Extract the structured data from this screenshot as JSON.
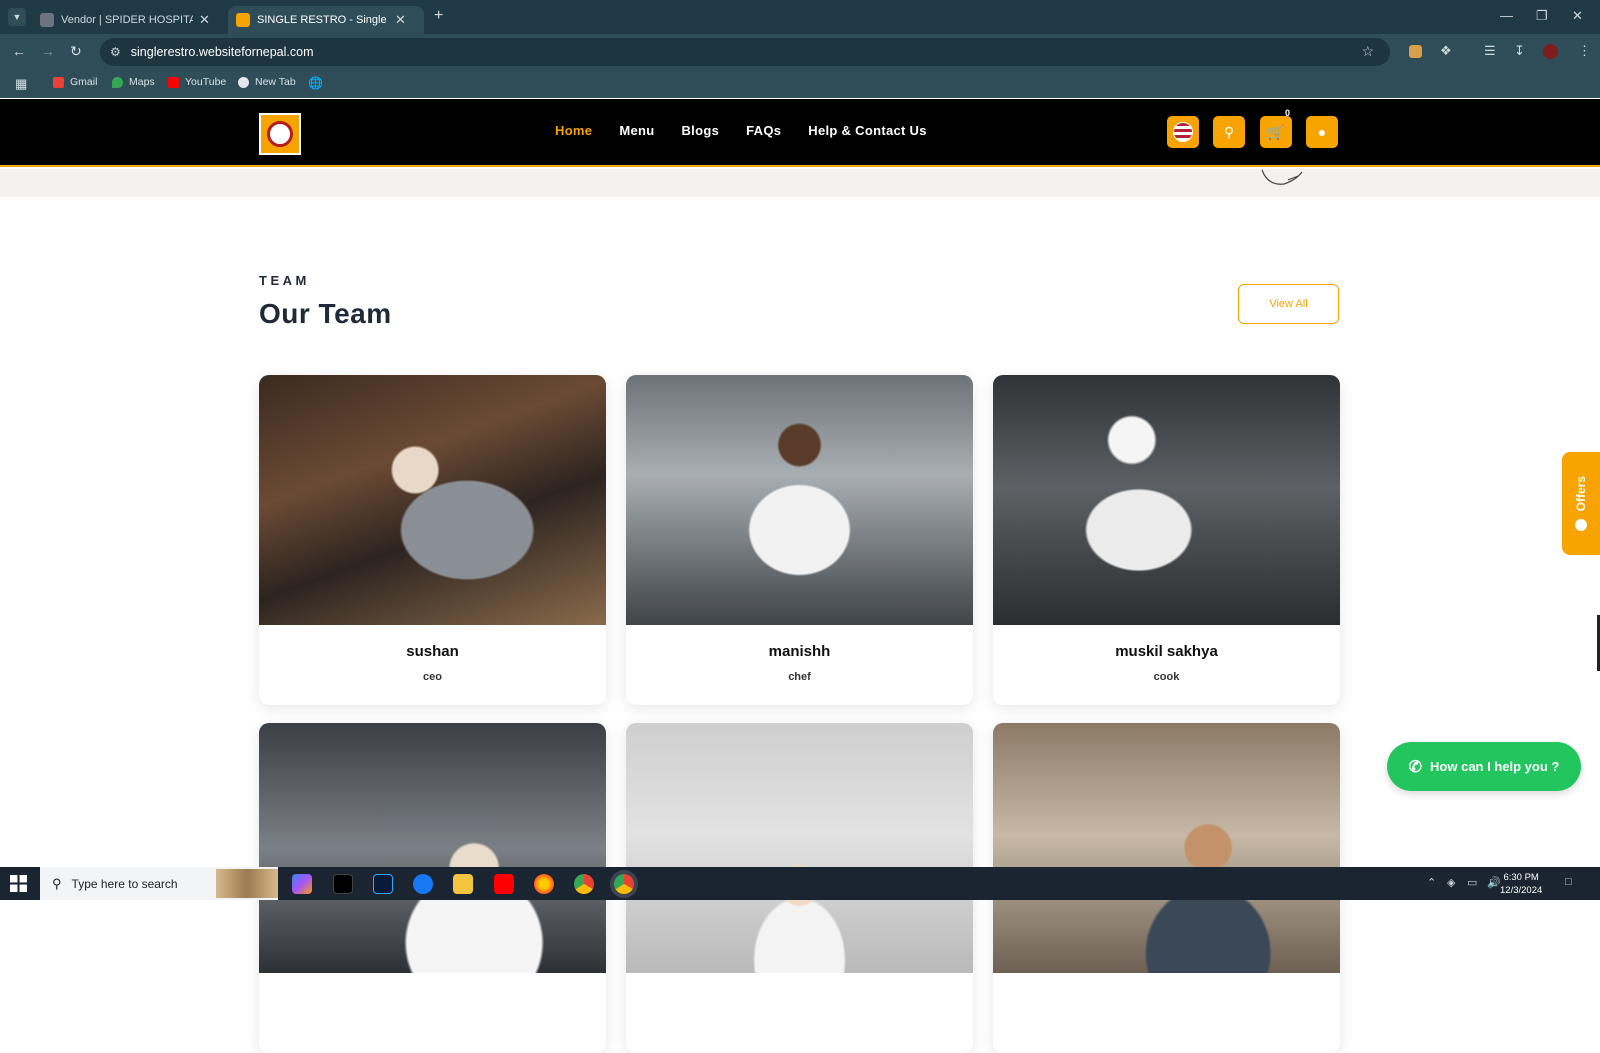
{
  "browser": {
    "tabs": [
      {
        "title": "Vendor | SPIDER HOSPITALITY F",
        "active": false
      },
      {
        "title": "SINGLE RESTRO - Single Restau",
        "active": true
      }
    ],
    "url": "singlerestro.websitefornepal.com",
    "bookmarks": [
      "Gmail",
      "Maps",
      "YouTube",
      "New Tab"
    ]
  },
  "site": {
    "nav": [
      "Home",
      "Menu",
      "Blogs",
      "FAQs",
      "Help & Contact Us"
    ],
    "active_nav": "Home",
    "cart_count": "0",
    "accent": "#f7a300"
  },
  "team": {
    "tag": "TEAM",
    "title": "Our Team",
    "view_all": "View All",
    "members": [
      {
        "name": "sushan",
        "role": "ceo"
      },
      {
        "name": "manishh",
        "role": "chef"
      },
      {
        "name": "muskil sakhya",
        "role": "cook"
      },
      {
        "name": "",
        "role": ""
      },
      {
        "name": "",
        "role": ""
      },
      {
        "name": "",
        "role": ""
      }
    ]
  },
  "widgets": {
    "offers": "Offers",
    "help": "How can I help you ?"
  },
  "taskbar": {
    "search_placeholder": "Type here to search",
    "time": "6:30 PM",
    "date": "12/3/2024"
  }
}
